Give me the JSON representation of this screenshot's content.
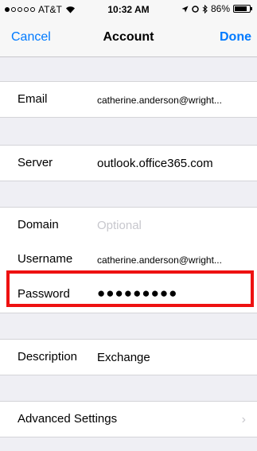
{
  "status_bar": {
    "carrier": "AT&T",
    "time": "10:32 AM",
    "battery": "86%",
    "battery_level": 0.86,
    "icons": [
      "signal-dots-icon",
      "wifi-icon",
      "location-icon",
      "alarm-icon",
      "bluetooth-icon",
      "battery-icon"
    ]
  },
  "nav": {
    "cancel_label": "Cancel",
    "title": "Account",
    "done_label": "Done"
  },
  "fields": {
    "email": {
      "label": "Email",
      "value": "catherine.anderson@wright..."
    },
    "server": {
      "label": "Server",
      "value": "outlook.office365.com"
    },
    "domain": {
      "label": "Domain",
      "placeholder": "Optional"
    },
    "username": {
      "label": "Username",
      "value": "catherine.anderson@wright..."
    },
    "password": {
      "label": "Password",
      "value": "●●●●●●●●●"
    },
    "description": {
      "label": "Description",
      "value": "Exchange"
    }
  },
  "advanced": {
    "label": "Advanced Settings",
    "chevron": "›"
  },
  "colors": {
    "accent": "#007aff",
    "highlight": "#ee1111",
    "background": "#efeff4"
  }
}
